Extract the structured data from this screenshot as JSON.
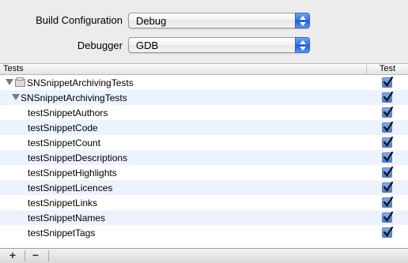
{
  "form": {
    "build_configuration": {
      "label": "Build Configuration",
      "value": "Debug"
    },
    "debugger": {
      "label": "Debugger",
      "value": "GDB"
    }
  },
  "table": {
    "columns": {
      "tests": "Tests",
      "test": "Test"
    },
    "rows": [
      {
        "label": "SNSnippetArchivingTests",
        "level": 0,
        "checked": true
      },
      {
        "label": "SNSnippetArchivingTests",
        "level": 1,
        "checked": true
      },
      {
        "label": "testSnippetAuthors",
        "level": 2,
        "checked": true
      },
      {
        "label": "testSnippetCode",
        "level": 2,
        "checked": true
      },
      {
        "label": "testSnippetCount",
        "level": 2,
        "checked": true
      },
      {
        "label": "testSnippetDescriptions",
        "level": 2,
        "checked": true
      },
      {
        "label": "testSnippetHighlights",
        "level": 2,
        "checked": true
      },
      {
        "label": "testSnippetLicences",
        "level": 2,
        "checked": true
      },
      {
        "label": "testSnippetLinks",
        "level": 2,
        "checked": true
      },
      {
        "label": "testSnippetNames",
        "level": 2,
        "checked": true
      },
      {
        "label": "testSnippetTags",
        "level": 2,
        "checked": true
      }
    ]
  },
  "bottombar": {
    "add_label": "+",
    "remove_label": "−"
  },
  "colors": {
    "selection_blue": "#3d7fe3",
    "alt_row": "#edf3fe"
  }
}
